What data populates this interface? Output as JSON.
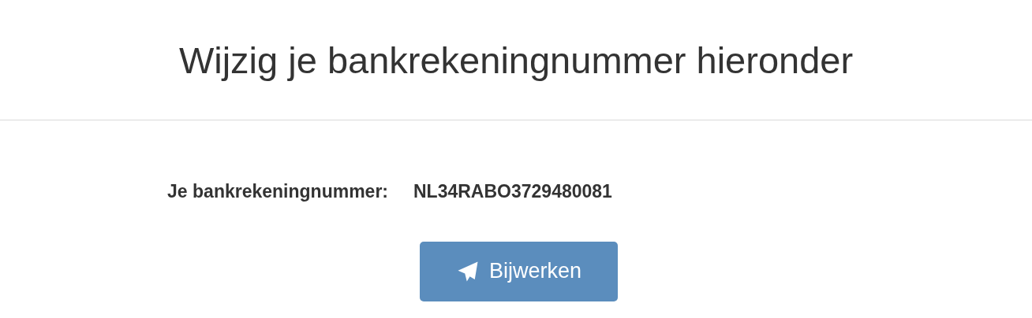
{
  "title": "Wijzig je bankrekeningnummer hieronder",
  "account": {
    "label": "Je bankrekeningnummer:",
    "value": "NL34RABO3729480081"
  },
  "button": {
    "label": "Bijwerken"
  }
}
